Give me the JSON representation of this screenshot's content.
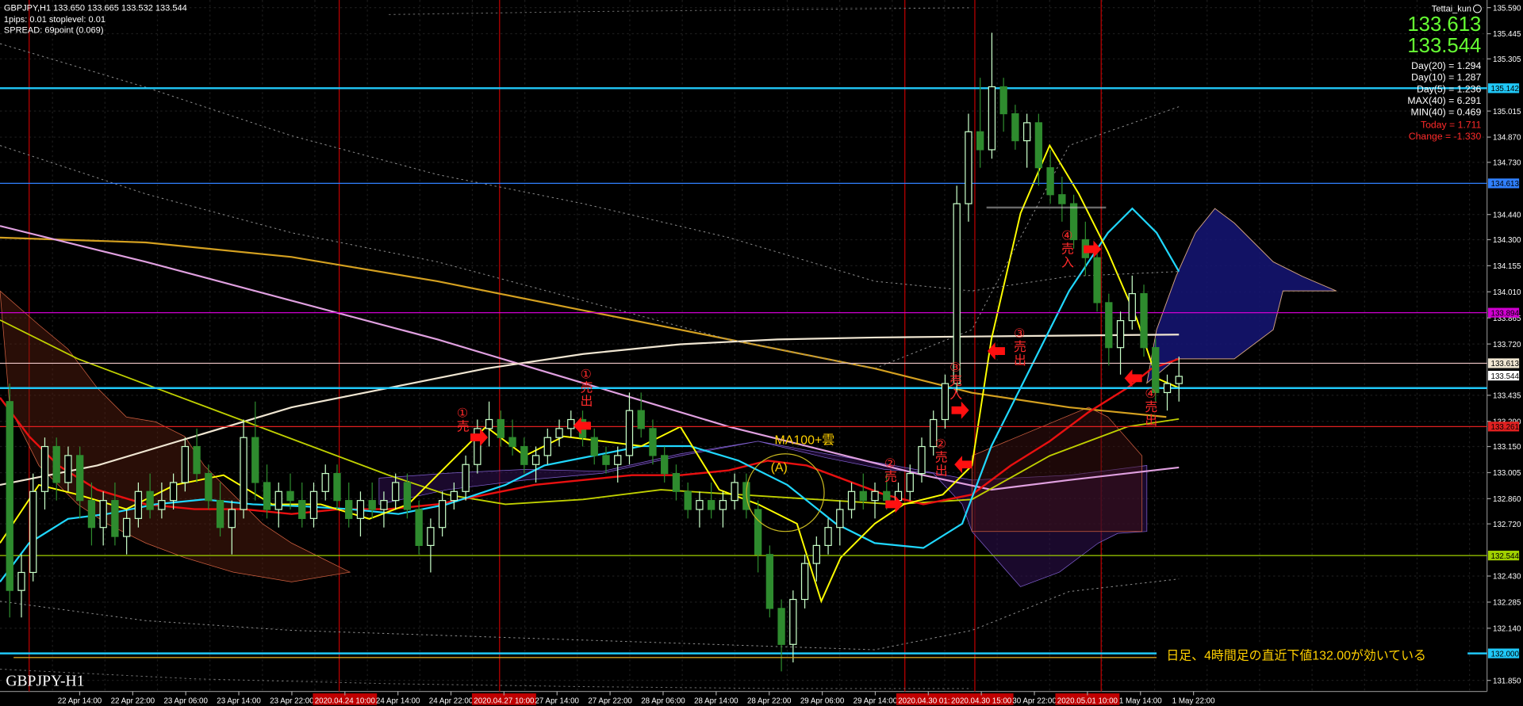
{
  "header": {
    "line1": "GBPJPY,H1  133.650 133.665 133.532 133.544",
    "line2": "1pips: 0.01  stoplevel: 0.01",
    "line3": "SPREAD: 69point (0.069)"
  },
  "hud": {
    "user": "Tettai_kun",
    "bid": "133.613",
    "ask": "133.544",
    "stats": [
      "Day(20) = 1.294",
      "Day(10) = 1.287",
      "Day(5) = 1.236",
      "MAX(40) = 6.291",
      "MIN(40) = 0.469"
    ],
    "today": "Today = 1.711",
    "change": "Change = -1.330"
  },
  "symbol_label": "GBPJPY-H1",
  "note_label": "日足、4時間足の直近下値132.00が効いている",
  "annotations": {
    "a1_sell": "①\n売",
    "a1_exit": "①\n売\n出",
    "a2_sell": "②\n売",
    "a2_exit": "②\n売\n出",
    "a3_sell": "③\n売\n入",
    "a3_exit": "③\n売\n出",
    "a4_sell": "④\n売\n入",
    "a4_exit": "④\n売\n出",
    "ma_cloud": "MA100+雲",
    "point_a": "(A)"
  },
  "colors": {
    "background": "#000000",
    "bull_candle": "#c8ffc8",
    "bear_candle": "#2e8b2e",
    "ma_fast": "#ffff00",
    "ma_red": "#e81010",
    "ma_cyan": "#20d8ff",
    "ma_orange": "#d4a020",
    "ma_white": "#f0e6d2",
    "ma_pink": "#e0a0e0",
    "ma_lime": "#c0d000",
    "hline_cyan": "#20c8f8",
    "hline_blue": "#3080ff",
    "hline_magenta": "#d000d0",
    "hline_red": "#e02020",
    "hline_lime": "#a0d000",
    "vline": "#e01010",
    "cloud_red": "#d06040",
    "cloud_blue": "#5050d0",
    "signal_arrow": "#ff1010"
  },
  "chart_data": {
    "type": "candlestick",
    "symbol": "GBPJPY",
    "timeframe": "H1",
    "ylim": [
      131.81,
      135.6
    ],
    "y_ticks": [
      {
        "value": 135.59,
        "label": "135.590"
      },
      {
        "value": 135.445,
        "label": "135.445"
      },
      {
        "value": 135.305,
        "label": "135.305"
      },
      {
        "value": 135.015,
        "label": "135.015"
      },
      {
        "value": 134.87,
        "label": "134.870"
      },
      {
        "value": 134.73,
        "label": "134.730"
      },
      {
        "value": 134.44,
        "label": "134.440"
      },
      {
        "value": 134.3,
        "label": "134.300"
      },
      {
        "value": 134.155,
        "label": "134.155"
      },
      {
        "value": 134.01,
        "label": "134.010"
      },
      {
        "value": 133.865,
        "label": "133.865"
      },
      {
        "value": 133.72,
        "label": "133.720"
      },
      {
        "value": 133.435,
        "label": "133.435"
      },
      {
        "value": 133.29,
        "label": "133.290"
      },
      {
        "value": 133.15,
        "label": "133.150"
      },
      {
        "value": 133.005,
        "label": "133.005"
      },
      {
        "value": 132.86,
        "label": "132.860"
      },
      {
        "value": 132.72,
        "label": "132.720"
      },
      {
        "value": 132.43,
        "label": "132.430"
      },
      {
        "value": 132.285,
        "label": "132.285"
      },
      {
        "value": 132.14,
        "label": "132.140"
      },
      {
        "value": 131.85,
        "label": "131.850"
      }
    ],
    "x_ticks": [
      {
        "label": "22 Apr 14:00",
        "highlight": false
      },
      {
        "label": "22 Apr 22:00",
        "highlight": false
      },
      {
        "label": "23 Apr 06:00",
        "highlight": false
      },
      {
        "label": "23 Apr 14:00",
        "highlight": false
      },
      {
        "label": "23 Apr 22:00",
        "highlight": false
      },
      {
        "label": "2020.04.24 10:00",
        "highlight": true
      },
      {
        "label": "24 Apr 14:00",
        "highlight": false
      },
      {
        "label": "24 Apr 22:00",
        "highlight": false
      },
      {
        "label": "2020.04.27 10:00",
        "highlight": true
      },
      {
        "label": "27 Apr 14:00",
        "highlight": false
      },
      {
        "label": "27 Apr 22:00",
        "highlight": false
      },
      {
        "label": "28 Apr 06:00",
        "highlight": false
      },
      {
        "label": "28 Apr 14:00",
        "highlight": false
      },
      {
        "label": "28 Apr 22:00",
        "highlight": false
      },
      {
        "label": "29 Apr 06:00",
        "highlight": false
      },
      {
        "label": "29 Apr 14:00",
        "highlight": false
      },
      {
        "label": "2020.04.30 01:00",
        "highlight": true
      },
      {
        "label": "2020.04.30 15:00",
        "highlight": true
      },
      {
        "label": "30 Apr 22:00",
        "highlight": false
      },
      {
        "label": "2020.05.01 10:00",
        "highlight": true
      },
      {
        "label": "1 May 14:00",
        "highlight": false
      },
      {
        "label": "1 May 22:00",
        "highlight": false
      }
    ],
    "price_tags": [
      {
        "value": 135.142,
        "label": "135.142",
        "color": "#20c8f8"
      },
      {
        "value": 134.613,
        "label": "134.613",
        "color": "#3080ff"
      },
      {
        "value": 133.894,
        "label": "133.894",
        "color": "#d000d0"
      },
      {
        "value": 133.613,
        "label": "133.613",
        "color": "#f0e6d2"
      },
      {
        "value": 133.544,
        "label": "133.544",
        "color": "#ffffff"
      },
      {
        "value": 133.261,
        "label": "133.261",
        "color": "#e02020"
      },
      {
        "value": 132.544,
        "label": "132.544",
        "color": "#a0d000"
      },
      {
        "value": 132.0,
        "label": "132.000",
        "color": "#20c8f8"
      }
    ],
    "horizontal_lines": [
      {
        "value": 135.142,
        "color": "#20c8f8",
        "width": 2
      },
      {
        "value": 134.613,
        "color": "#3080ff",
        "width": 1
      },
      {
        "value": 133.894,
        "color": "#d000d0",
        "width": 1
      },
      {
        "value": 133.613,
        "color": "#f0c8c8",
        "width": 1
      },
      {
        "value": 133.475,
        "color": "#20c8f8",
        "width": 2
      },
      {
        "value": 133.261,
        "color": "#e02020",
        "width": 1
      },
      {
        "value": 132.544,
        "color": "#a0d000",
        "width": 1
      },
      {
        "value": 132.0,
        "color": "#20c8f8",
        "width": 2
      }
    ],
    "candles": [
      [
        133.4,
        133.5,
        132.2,
        132.35
      ],
      [
        132.35,
        132.55,
        132.2,
        132.45
      ],
      [
        132.45,
        133.0,
        132.4,
        132.9
      ],
      [
        132.9,
        133.2,
        132.8,
        133.15
      ],
      [
        133.15,
        133.2,
        132.85,
        132.95
      ],
      [
        132.95,
        133.15,
        132.9,
        133.1
      ],
      [
        133.1,
        133.15,
        132.75,
        132.85
      ],
      [
        132.85,
        132.95,
        132.6,
        132.7
      ],
      [
        132.7,
        132.9,
        132.6,
        132.85
      ],
      [
        132.85,
        132.95,
        132.6,
        132.65
      ],
      [
        132.65,
        132.8,
        132.55,
        132.75
      ],
      [
        132.75,
        132.95,
        132.7,
        132.9
      ],
      [
        132.9,
        133.0,
        132.75,
        132.8
      ],
      [
        132.8,
        132.95,
        132.75,
        132.85
      ],
      [
        132.85,
        133.0,
        132.8,
        132.95
      ],
      [
        132.95,
        133.2,
        132.9,
        133.15
      ],
      [
        133.15,
        133.25,
        132.95,
        133.0
      ],
      [
        133.0,
        133.05,
        132.8,
        132.85
      ],
      [
        132.85,
        132.95,
        132.65,
        132.7
      ],
      [
        132.7,
        132.85,
        132.55,
        132.8
      ],
      [
        132.8,
        133.3,
        132.75,
        133.2
      ],
      [
        133.2,
        133.4,
        132.85,
        132.95
      ],
      [
        132.95,
        133.05,
        132.75,
        132.8
      ],
      [
        132.8,
        132.95,
        132.7,
        132.9
      ],
      [
        132.9,
        133.0,
        132.8,
        132.85
      ],
      [
        132.85,
        132.95,
        132.7,
        132.75
      ],
      [
        132.75,
        132.95,
        132.7,
        132.9
      ],
      [
        132.9,
        133.05,
        132.85,
        133.0
      ],
      [
        133.0,
        133.05,
        132.8,
        132.85
      ],
      [
        132.85,
        132.95,
        132.7,
        132.75
      ],
      [
        132.75,
        132.9,
        132.65,
        132.85
      ],
      [
        132.85,
        132.95,
        132.75,
        132.8
      ],
      [
        132.8,
        132.9,
        132.7,
        132.85
      ],
      [
        132.85,
        133.0,
        132.8,
        132.95
      ],
      [
        132.95,
        133.0,
        132.75,
        132.8
      ],
      [
        132.8,
        132.85,
        132.55,
        132.6
      ],
      [
        132.6,
        132.75,
        132.45,
        132.7
      ],
      [
        132.7,
        132.9,
        132.65,
        132.85
      ],
      [
        132.85,
        132.95,
        132.8,
        132.9
      ],
      [
        132.9,
        133.1,
        132.85,
        133.05
      ],
      [
        133.05,
        133.3,
        133.0,
        133.25
      ],
      [
        133.25,
        133.4,
        133.15,
        133.3
      ],
      [
        133.3,
        133.35,
        133.15,
        133.2
      ],
      [
        133.2,
        133.3,
        133.1,
        133.15
      ],
      [
        133.15,
        133.2,
        133.0,
        133.05
      ],
      [
        133.05,
        133.15,
        132.95,
        133.1
      ],
      [
        133.1,
        133.25,
        133.05,
        133.2
      ],
      [
        133.2,
        133.3,
        133.15,
        133.25
      ],
      [
        133.25,
        133.35,
        133.2,
        133.3
      ],
      [
        133.3,
        133.35,
        133.15,
        133.2
      ],
      [
        133.2,
        133.25,
        133.05,
        133.1
      ],
      [
        133.1,
        133.15,
        133.0,
        133.05
      ],
      [
        133.05,
        133.15,
        132.95,
        133.1
      ],
      [
        133.1,
        133.45,
        133.05,
        133.35
      ],
      [
        133.35,
        133.45,
        133.2,
        133.25
      ],
      [
        133.25,
        133.3,
        133.05,
        133.1
      ],
      [
        133.1,
        133.15,
        132.95,
        133.0
      ],
      [
        133.0,
        133.05,
        132.85,
        132.9
      ],
      [
        132.9,
        132.95,
        132.75,
        132.8
      ],
      [
        132.8,
        132.9,
        132.7,
        132.85
      ],
      [
        132.85,
        132.95,
        132.75,
        132.8
      ],
      [
        132.8,
        132.9,
        132.7,
        132.85
      ],
      [
        132.85,
        133.0,
        132.8,
        132.95
      ],
      [
        132.95,
        133.0,
        132.75,
        132.8
      ],
      [
        132.8,
        132.85,
        132.45,
        132.55
      ],
      [
        132.55,
        132.6,
        132.2,
        132.25
      ],
      [
        132.25,
        132.3,
        131.9,
        132.05
      ],
      [
        132.05,
        132.35,
        131.95,
        132.3
      ],
      [
        132.3,
        132.55,
        132.25,
        132.5
      ],
      [
        132.5,
        132.65,
        132.4,
        132.6
      ],
      [
        132.6,
        132.75,
        132.55,
        132.7
      ],
      [
        132.7,
        132.85,
        132.6,
        132.8
      ],
      [
        132.8,
        132.95,
        132.75,
        132.9
      ],
      [
        132.9,
        133.0,
        132.8,
        132.85
      ],
      [
        132.85,
        132.95,
        132.75,
        132.9
      ],
      [
        132.9,
        133.0,
        132.8,
        132.85
      ],
      [
        132.85,
        132.95,
        132.8,
        132.9
      ],
      [
        132.9,
        133.05,
        132.85,
        133.0
      ],
      [
        133.0,
        133.2,
        132.95,
        133.15
      ],
      [
        133.15,
        133.35,
        133.1,
        133.3
      ],
      [
        133.3,
        133.55,
        133.25,
        133.5
      ],
      [
        133.5,
        134.6,
        133.45,
        134.5
      ],
      [
        134.5,
        135.0,
        134.4,
        134.9
      ],
      [
        134.9,
        135.2,
        134.7,
        134.8
      ],
      [
        134.8,
        135.45,
        134.75,
        135.15
      ],
      [
        135.15,
        135.2,
        134.9,
        135.0
      ],
      [
        135.0,
        135.05,
        134.8,
        134.85
      ],
      [
        134.85,
        135.0,
        134.7,
        134.95
      ],
      [
        134.95,
        135.0,
        134.6,
        134.7
      ],
      [
        134.7,
        134.8,
        134.5,
        134.55
      ],
      [
        134.55,
        134.65,
        134.4,
        134.5
      ],
      [
        134.5,
        134.55,
        134.25,
        134.3
      ],
      [
        134.3,
        134.4,
        134.1,
        134.2
      ],
      [
        134.2,
        134.25,
        133.9,
        133.95
      ],
      [
        133.95,
        134.0,
        133.6,
        133.7
      ],
      [
        133.7,
        133.9,
        133.55,
        133.85
      ],
      [
        133.85,
        134.1,
        133.8,
        134.0
      ],
      [
        134.0,
        134.05,
        133.65,
        133.7
      ],
      [
        133.7,
        133.75,
        133.4,
        133.45
      ],
      [
        133.45,
        133.55,
        133.35,
        133.5
      ],
      [
        133.5,
        133.65,
        133.4,
        133.54
      ]
    ]
  }
}
